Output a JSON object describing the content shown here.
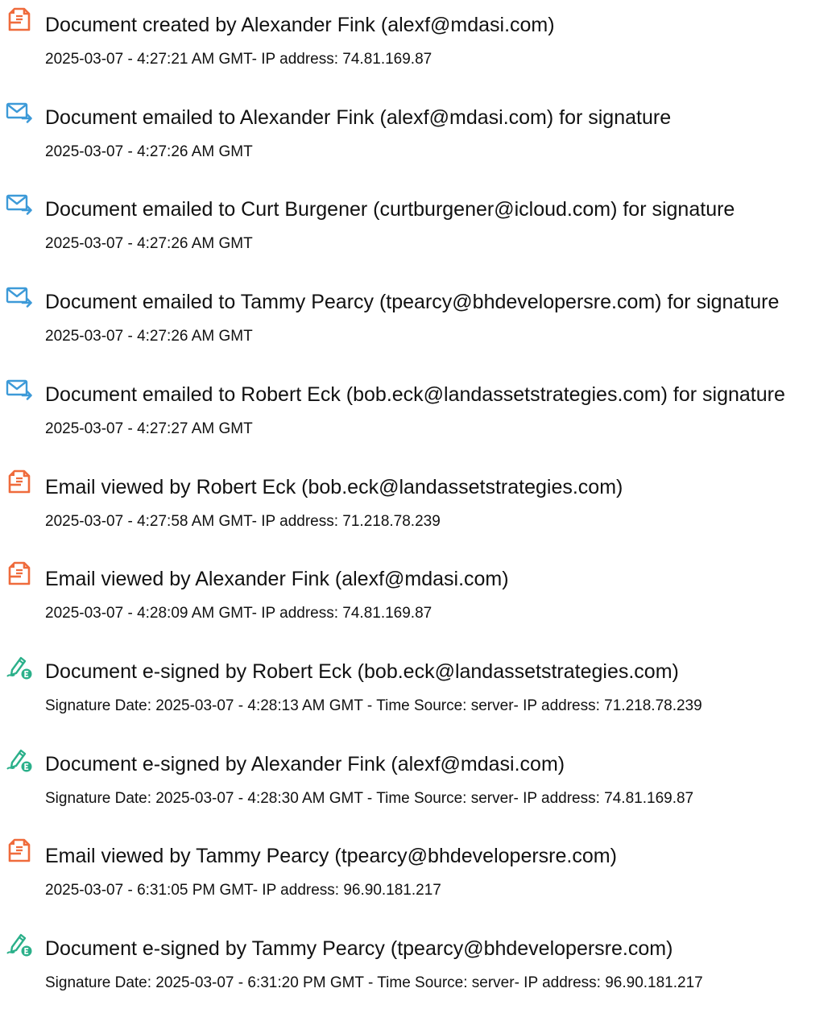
{
  "colors": {
    "document_icon": "#ef6b3c",
    "email_icon": "#3d9ad8",
    "sign_icon": "#2bb08a",
    "text": "#111111"
  },
  "events": [
    {
      "icon": "document-icon",
      "title": "Document created by Alexander Fink (alexf@mdasi.com)",
      "detail": "2025-03-07 - 4:27:21 AM GMT- IP address: 74.81.169.87"
    },
    {
      "icon": "email-send-icon",
      "title": "Document emailed to Alexander Fink (alexf@mdasi.com) for signature",
      "detail": "2025-03-07 - 4:27:26 AM GMT"
    },
    {
      "icon": "email-send-icon",
      "title": "Document emailed to Curt Burgener (curtburgener@icloud.com) for signature",
      "detail": "2025-03-07 - 4:27:26 AM GMT"
    },
    {
      "icon": "email-send-icon",
      "title": "Document emailed to Tammy Pearcy (tpearcy@bhdevelopersre.com) for signature",
      "detail": "2025-03-07 - 4:27:26 AM GMT"
    },
    {
      "icon": "email-send-icon",
      "title": "Document emailed to Robert Eck (bob.eck@landassetstrategies.com) for signature",
      "detail": "2025-03-07 - 4:27:27 AM GMT"
    },
    {
      "icon": "document-icon",
      "title": "Email viewed by Robert Eck (bob.eck@landassetstrategies.com)",
      "detail": "2025-03-07 - 4:27:58 AM GMT- IP address: 71.218.78.239"
    },
    {
      "icon": "document-icon",
      "title": "Email viewed by Alexander Fink (alexf@mdasi.com)",
      "detail": "2025-03-07 - 4:28:09 AM GMT- IP address: 74.81.169.87"
    },
    {
      "icon": "e-sign-pen-icon",
      "title": "Document e-signed by Robert Eck (bob.eck@landassetstrategies.com)",
      "detail": "Signature Date: 2025-03-07 - 4:28:13 AM GMT - Time Source: server- IP address: 71.218.78.239"
    },
    {
      "icon": "e-sign-pen-icon",
      "title": "Document e-signed by Alexander Fink (alexf@mdasi.com)",
      "detail": "Signature Date: 2025-03-07 - 4:28:30 AM GMT - Time Source: server- IP address: 74.81.169.87"
    },
    {
      "icon": "document-icon",
      "title": "Email viewed by Tammy Pearcy (tpearcy@bhdevelopersre.com)",
      "detail": "2025-03-07 - 6:31:05 PM GMT- IP address: 96.90.181.217"
    },
    {
      "icon": "e-sign-pen-icon",
      "title": "Document e-signed by Tammy Pearcy (tpearcy@bhdevelopersre.com)",
      "detail": "Signature Date: 2025-03-07 - 6:31:20 PM GMT - Time Source: server- IP address: 96.90.181.217"
    }
  ]
}
